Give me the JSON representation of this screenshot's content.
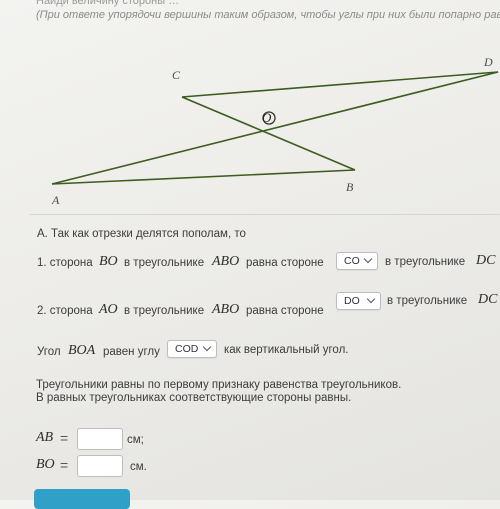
{
  "task": {
    "header_line1": "Найди величину стороны …",
    "header_line2": "(При ответе упорядочи вершины таким образом, чтобы углы при них были попарно равны)"
  },
  "figure": {
    "points": {
      "A": "A",
      "B": "B",
      "C": "C",
      "D": "D",
      "O": "O"
    },
    "line_color": "#3d5c1f"
  },
  "solution": {
    "intro": "А. Так как отрезки делятся пополам, то",
    "line1": {
      "prefix": "1. сторона",
      "seg": "BO",
      "mid": "в треугольнике",
      "tri1": "ABO",
      "eq": "равна стороне",
      "select_value": "CO",
      "suffix": "в треугольнике",
      "tri2": "DC"
    },
    "line2": {
      "prefix": "2. сторона",
      "seg": "AO",
      "mid": "в треугольнике",
      "tri1": "ABO",
      "eq": "равна стороне",
      "select_value": "DO",
      "suffix": "в треугольнике",
      "tri2": "DC"
    },
    "angle": {
      "prefix": "Угол",
      "angle_name": "BOA",
      "mid": "равен углу",
      "select_value": "COD",
      "suffix": "как вертикальный угол."
    },
    "conclusion_line1": "Треугольники равны по первому признаку равенства треугольников.",
    "conclusion_line2": "В равных треугольниках соответствующие стороны равны.",
    "answers": [
      {
        "label": "AB",
        "eq": "=",
        "value": "",
        "unit": "см;"
      },
      {
        "label": "BO",
        "eq": "=",
        "value": "",
        "unit": "см."
      }
    ]
  },
  "colors": {
    "accent": "#2fa0c7",
    "background": "#efeeea"
  }
}
